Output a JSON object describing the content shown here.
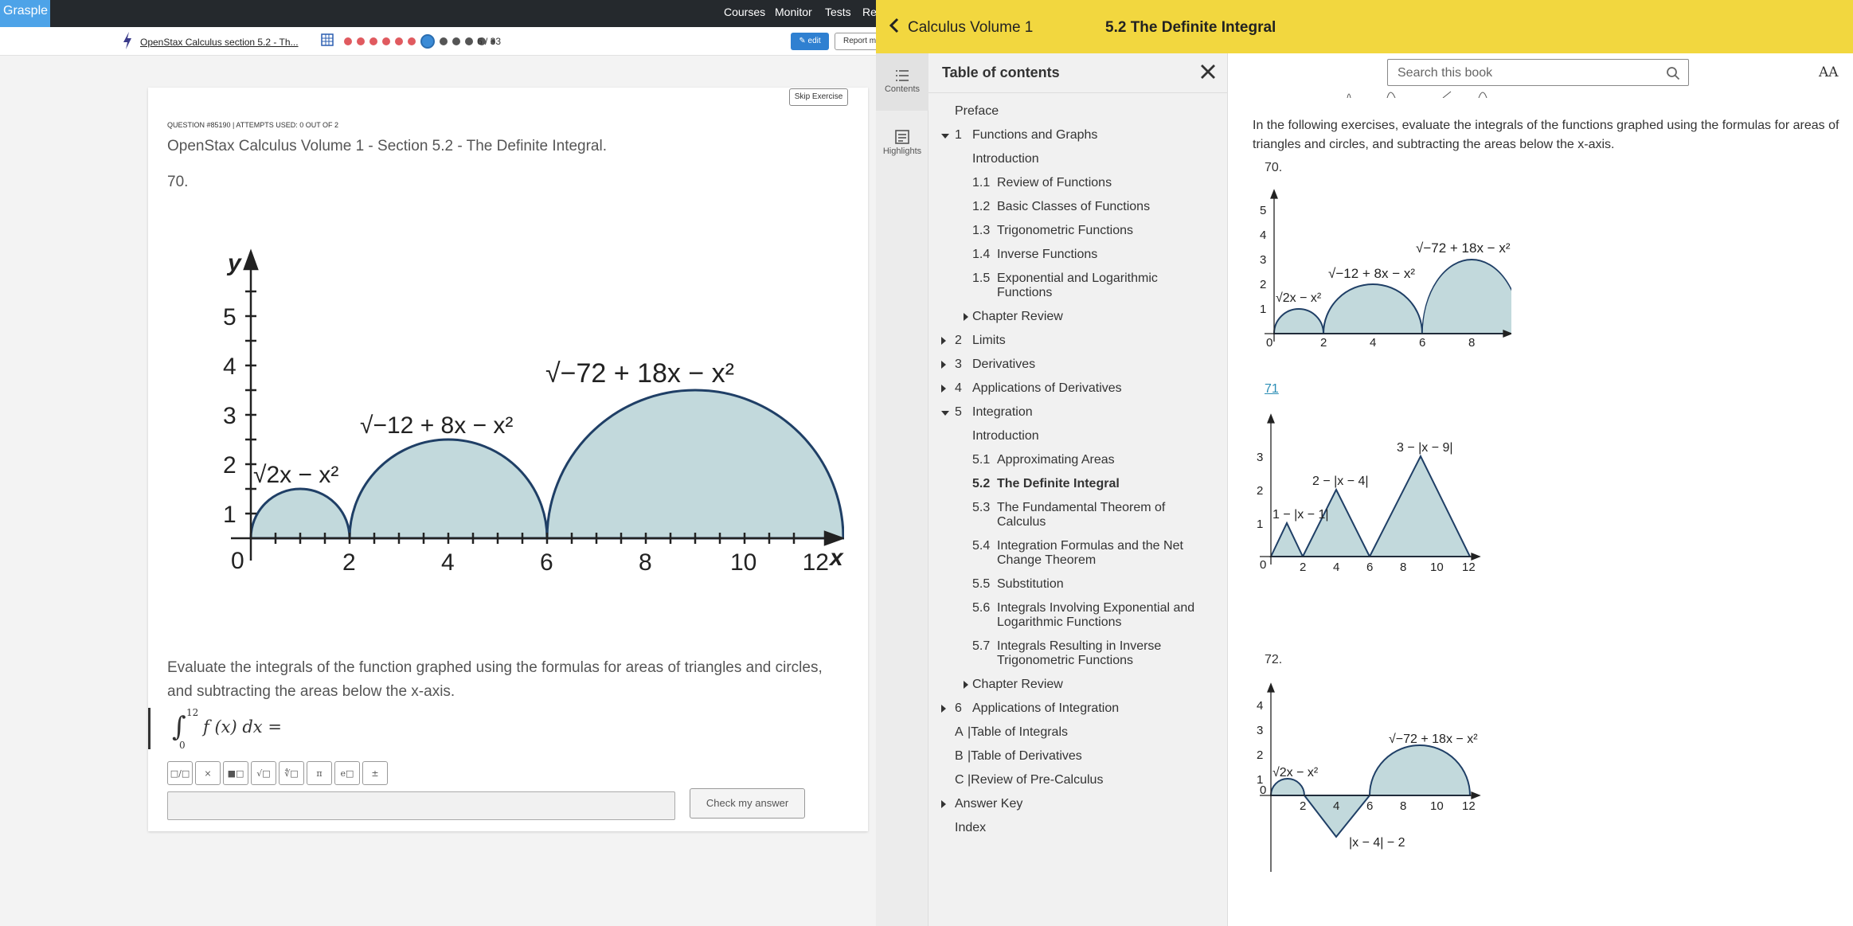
{
  "grasple": {
    "logo": "Grasple",
    "nav": [
      "Courses",
      "Monitor",
      "Tests",
      "Re"
    ],
    "breadcrumb": "OpenStax Calculus section 5.2 - Th...",
    "progress_counter": "6 / 33",
    "edit_label": "✎ edit",
    "report_label": "Report m",
    "skip_label": "Skip Exercise",
    "question_meta": "QUESTION #85190 |  ATTEMPTS USED: 0 OUT OF 2",
    "question_title": "OpenStax Calculus Volume 1 - Section 5.2 - The Definite Integral.",
    "question_number": "70.",
    "instruction": "Evaluate the integrals of the function graphed using the formulas for areas of triangles and circles, and subtracting the areas below the x-axis.",
    "integral_upper": "12",
    "integral_lower": "0",
    "integrand": "f (x) dx =",
    "math_tools": [
      "□/□",
      "×",
      "■□",
      "√□",
      "∜□",
      "π",
      "e□",
      "±"
    ],
    "check_label": "Check my answer"
  },
  "openstax": {
    "book_title": "Calculus Volume 1",
    "section_title": "5.2 The Definite Integral",
    "side_tabs": [
      "Contents",
      "Highlights"
    ],
    "toc_title": "Table of contents",
    "search_placeholder": "Search this book",
    "font_button": "AA",
    "toc": [
      {
        "num": "",
        "label": "Preface",
        "indent": 0,
        "arrow": ""
      },
      {
        "num": "1",
        "label": "Functions and Graphs",
        "indent": 0,
        "arrow": "down"
      },
      {
        "num": "",
        "label": "Introduction",
        "indent": 1,
        "arrow": ""
      },
      {
        "num": "1.1",
        "label": "Review of Functions",
        "indent": 1,
        "arrow": ""
      },
      {
        "num": "1.2",
        "label": "Basic Classes of Functions",
        "indent": 1,
        "arrow": ""
      },
      {
        "num": "1.3",
        "label": "Trigonometric Functions",
        "indent": 1,
        "arrow": ""
      },
      {
        "num": "1.4",
        "label": "Inverse Functions",
        "indent": 1,
        "arrow": ""
      },
      {
        "num": "1.5",
        "label": "Exponential and Logarithmic",
        "label2": "Functions",
        "indent": 1,
        "arrow": ""
      },
      {
        "num": "",
        "label": "Chapter Review",
        "indent": 1,
        "arrow": "right"
      },
      {
        "num": "2",
        "label": "Limits",
        "indent": 0,
        "arrow": "right"
      },
      {
        "num": "3",
        "label": "Derivatives",
        "indent": 0,
        "arrow": "right"
      },
      {
        "num": "4",
        "label": "Applications of Derivatives",
        "indent": 0,
        "arrow": "right"
      },
      {
        "num": "5",
        "label": "Integration",
        "indent": 0,
        "arrow": "down"
      },
      {
        "num": "",
        "label": "Introduction",
        "indent": 1,
        "arrow": ""
      },
      {
        "num": "5.1",
        "label": "Approximating Areas",
        "indent": 1,
        "arrow": ""
      },
      {
        "num": "5.2",
        "label": "The Definite Integral",
        "indent": 1,
        "arrow": "",
        "bold": true
      },
      {
        "num": "5.3",
        "label": "The Fundamental Theorem of",
        "label2": "Calculus",
        "indent": 1,
        "arrow": ""
      },
      {
        "num": "5.4",
        "label": "Integration Formulas and the Net",
        "label2": "Change Theorem",
        "indent": 1,
        "arrow": ""
      },
      {
        "num": "5.5",
        "label": "Substitution",
        "indent": 1,
        "arrow": ""
      },
      {
        "num": "5.6",
        "label": "Integrals Involving Exponential and",
        "label2": "Logarithmic Functions",
        "indent": 1,
        "arrow": ""
      },
      {
        "num": "5.7",
        "label": "Integrals Resulting in Inverse",
        "label2": "Trigonometric Functions",
        "indent": 1,
        "arrow": ""
      },
      {
        "num": "",
        "label": "Chapter Review",
        "indent": 1,
        "arrow": "right"
      },
      {
        "num": "6",
        "label": "Applications of Integration",
        "indent": 0,
        "arrow": "right"
      },
      {
        "num": "A",
        "label": "|Table of Integrals",
        "indent": 0,
        "arrow": "",
        "letter": true
      },
      {
        "num": "B",
        "label": "|Table of Derivatives",
        "indent": 0,
        "arrow": "",
        "letter": true
      },
      {
        "num": "C",
        "label": "|Review of Pre-Calculus",
        "indent": 0,
        "arrow": "",
        "letter": true
      },
      {
        "num": "",
        "label": "Answer Key",
        "indent": 0,
        "arrow": "right"
      },
      {
        "num": "",
        "label": "Index",
        "indent": 0,
        "arrow": ""
      }
    ],
    "intro_text": "In the following exercises, evaluate the integrals of the functions graphed using the formulas for areas of triangles and circles, and subtracting the areas below the x-axis.",
    "exercises": [
      "70.",
      "71",
      "72."
    ]
  },
  "graph": {
    "x_ticks": [
      "0",
      "2",
      "4",
      "6",
      "8",
      "10",
      "12"
    ],
    "y_ticks": [
      "1",
      "2",
      "3",
      "4",
      "5"
    ],
    "axis_x": "x",
    "axis_y": "y",
    "labels": [
      "√2x − x²",
      "√−12 + 8x − x²",
      "√−72 + 18x − x²"
    ],
    "labels71": [
      "1 − |x − 1|",
      "2 − |x − 4|",
      "3 − |x − 9|"
    ],
    "labels72": [
      "√2x − x²",
      "√−72 + 18x − x²",
      "|x − 4| − 2"
    ]
  },
  "colors": {
    "fill": "#c2d9dc",
    "stroke": "#1f3f66",
    "header": "#f2d73f"
  }
}
